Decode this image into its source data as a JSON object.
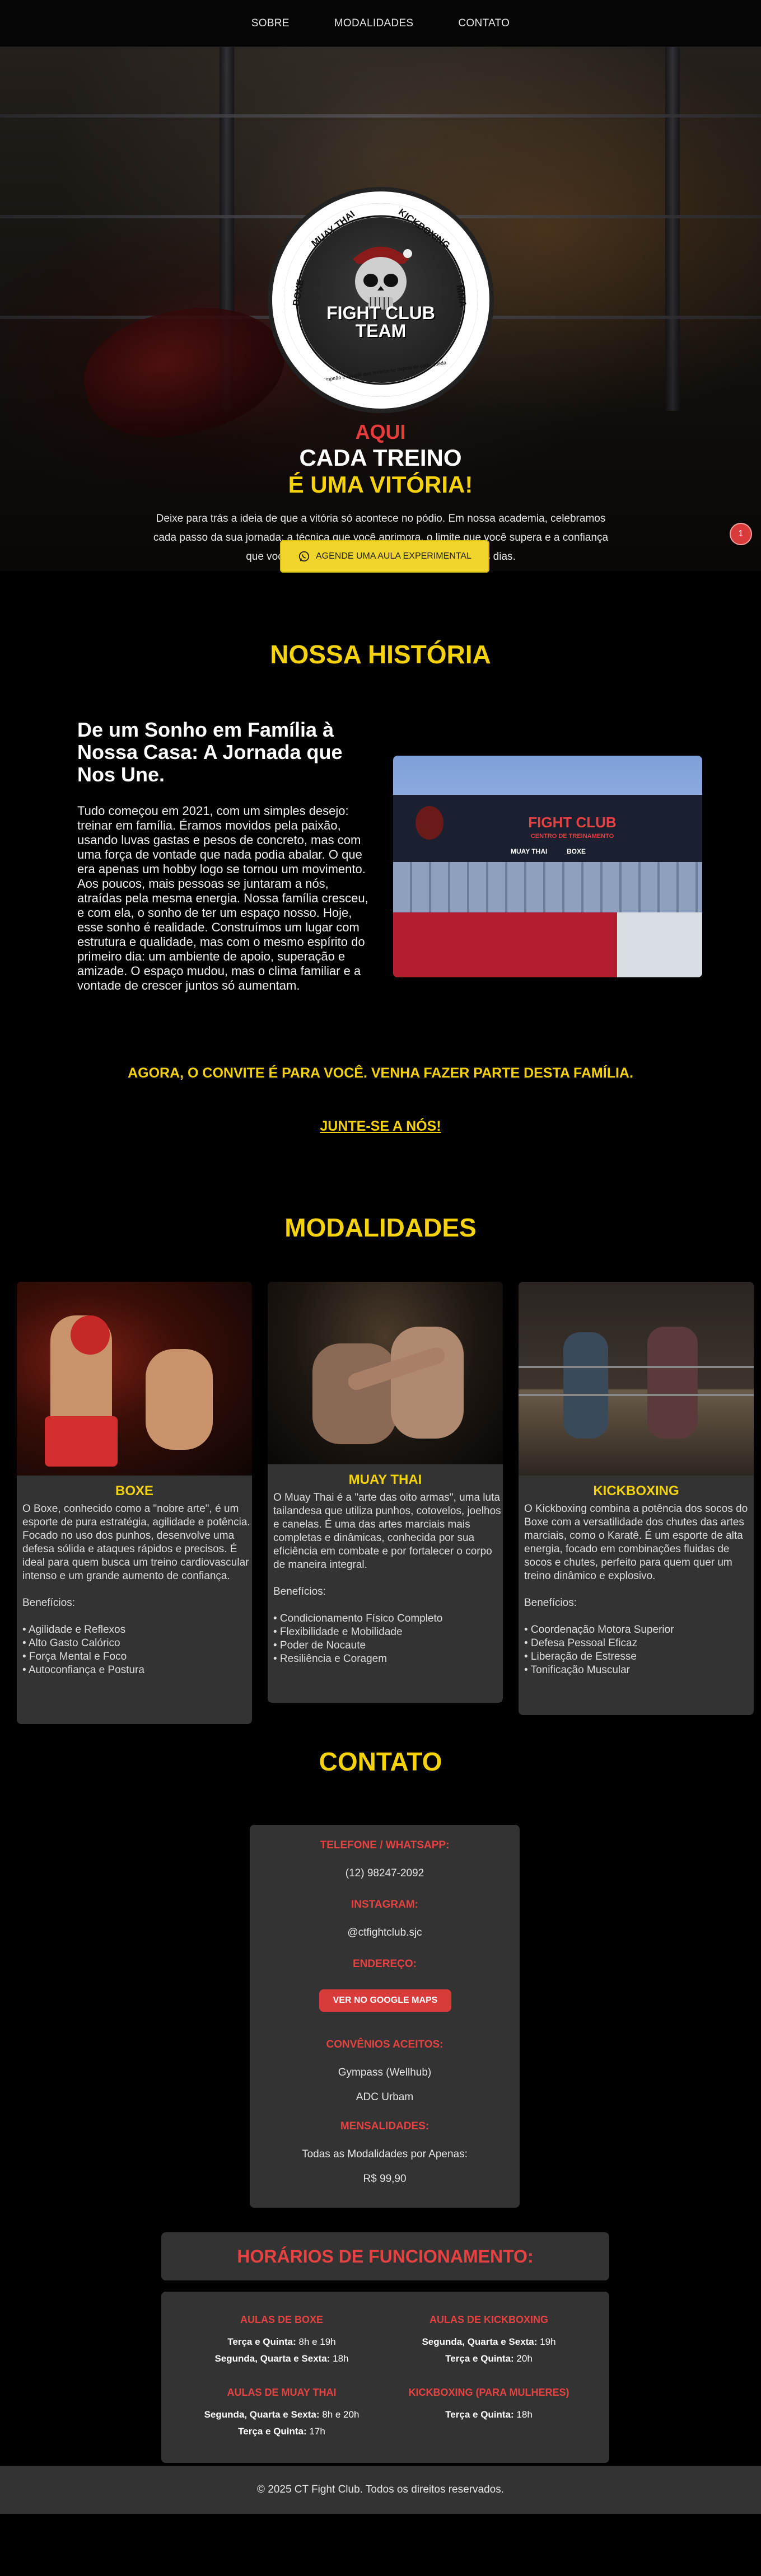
{
  "nav": {
    "items": [
      "SOBRE",
      "MODALIDADES",
      "CONTATO"
    ]
  },
  "hero": {
    "logo": {
      "arc_left": "BOXE",
      "arc_top_left": "MUAY THAI",
      "arc_top_right": "KICKBOXING",
      "arc_right": "MMA",
      "name_line1": "FIGHT CLUB",
      "name_line2": "TEAM",
      "bottom_arc": "O campeão é aquele que levanta-se depois de cada queda"
    },
    "title_line1": "AQUI",
    "title_line2": "CADA TREINO",
    "title_line3": "É UMA VITÓRIA!",
    "description": "Deixe para trás a ideia de que a vitória só acontece no pódio. Em nossa academia, celebramos cada passo da sua jornada: a técnica que você aprimora, o limite que você supera e a confiança que você constrói. Prepare-se para vencer todos os dias.",
    "cta_label": "AGENDE UMA AULA EXPERIMENTAL",
    "badge": "1"
  },
  "historia": {
    "title": "NOSSA HISTÓRIA",
    "subtitle": "De um Sonho em Família à Nossa Casa: A Jornada que Nos Une.",
    "text": "Tudo começou em 2021, com um simples desejo: treinar em família. Éramos movidos pela paixão, usando luvas gastas e pesos de concreto, mas com uma força de vontade que nada podia abalar. O que era apenas um hobby logo se tornou um movimento. Aos poucos, mais pessoas se juntaram a nós, atraídas pela mesma energia. Nossa família cresceu, e com ela, o sonho de ter um espaço nosso. Hoje, esse sonho é realidade. Construímos um lugar com estrutura e qualidade, mas com o mesmo espírito do primeiro dia: um ambiente de apoio, superação e amizade. O espaço mudou, mas o clima familiar e a vontade de crescer juntos só aumentam.",
    "image_sign": "FIGHT CLUB",
    "image_sign_sub": "CENTRO DE TREINAMENTO",
    "image_sign_items": [
      "MUAY THAI",
      "BOXE"
    ],
    "invite": "AGORA, O CONVITE É PARA VOCÊ. VENHA FAZER PARTE DESTA FAMÍLIA.",
    "join_link": "JUNTE-SE A NÓS!"
  },
  "modalidades": {
    "title": "MODALIDADES",
    "benefits_label": "Benefícios:",
    "items": [
      {
        "name": "BOXE",
        "description": "O Boxe, conhecido como a \"nobre arte\", é um esporte de pura estratégia, agilidade e potência. Focado no uso dos punhos, desenvolve uma defesa sólida e ataques rápidos e precisos. É ideal para quem busca um treino cardiovascular intenso e um grande aumento de confiança.",
        "benefits": [
          "• Agilidade e Reflexos",
          "• Alto Gasto Calórico",
          "• Força Mental e Foco",
          "• Autoconfiança e Postura"
        ]
      },
      {
        "name": "MUAY THAI",
        "description": "O Muay Thai é a \"arte das oito armas\", uma luta tailandesa que utiliza punhos, cotovelos, joelhos e canelas. É uma das artes marciais mais completas e dinâmicas, conhecida por sua eficiência em combate e por fortalecer o corpo de maneira integral.",
        "benefits": [
          "• Condicionamento Físico Completo",
          "• Flexibilidade e Mobilidade",
          "• Poder de Nocaute",
          "• Resiliência e Coragem"
        ]
      },
      {
        "name": "KICKBOXING",
        "description": "O Kickboxing combina a potência dos socos do Boxe com a versatilidade dos chutes das artes marciais, como o Karatê. É um esporte de alta energia, focado em combinações fluidas de socos e chutes, perfeito para quem quer um treino dinâmico e explosivo.",
        "benefits": [
          "• Coordenação Motora Superior",
          "• Defesa Pessoal Eficaz",
          "• Liberação de Estresse",
          "• Tonificação Muscular"
        ]
      }
    ]
  },
  "contato": {
    "title": "CONTATO",
    "phone_label": "TELEFONE / WHATSAPP:",
    "phone": "(12) 98247-2092",
    "instagram_label": "INSTAGRAM:",
    "instagram": "@ctfightclub.sjc",
    "address_label": "ENDEREÇO:",
    "maps_button": "VER NO GOOGLE MAPS",
    "convenios_label": "CONVÊNIOS ACEITOS:",
    "convenios": [
      "Gympass (Wellhub)",
      "ADC Urbam"
    ],
    "mensalidades_label": "MENSALIDADES:",
    "mensalidades_desc": "Todas as Modalidades por Apenas:",
    "price": "R$ 99,90"
  },
  "horarios": {
    "title": "HORÁRIOS DE FUNCIONAMENTO:",
    "blocks": [
      {
        "label": "AULAS DE BOXE",
        "lines": [
          {
            "days": "Terça e Quinta:",
            "time": "8h e 19h"
          },
          {
            "days": "Segunda, Quarta e Sexta:",
            "time": "18h"
          }
        ]
      },
      {
        "label": "AULAS DE KICKBOXING",
        "lines": [
          {
            "days": "Segunda, Quarta e Sexta:",
            "time": "19h"
          },
          {
            "days": "Terça e Quinta:",
            "time": "20h"
          }
        ]
      },
      {
        "label": "AULAS DE MUAY THAI",
        "lines": [
          {
            "days": "Segunda, Quarta e Sexta:",
            "time": "8h e 20h"
          },
          {
            "days": "Terça e Quinta:",
            "time": "17h"
          }
        ]
      },
      {
        "label": "KICKBOXING (PARA MULHERES)",
        "lines": [
          {
            "days": "Terça e Quinta:",
            "time": "18h"
          }
        ]
      }
    ]
  },
  "footer": {
    "text": "© 2025 CT Fight Club. Todos os direitos reservados."
  },
  "colors": {
    "accent_yellow": "#f5d20a",
    "accent_red": "#e74242",
    "card_bg": "#333333"
  }
}
